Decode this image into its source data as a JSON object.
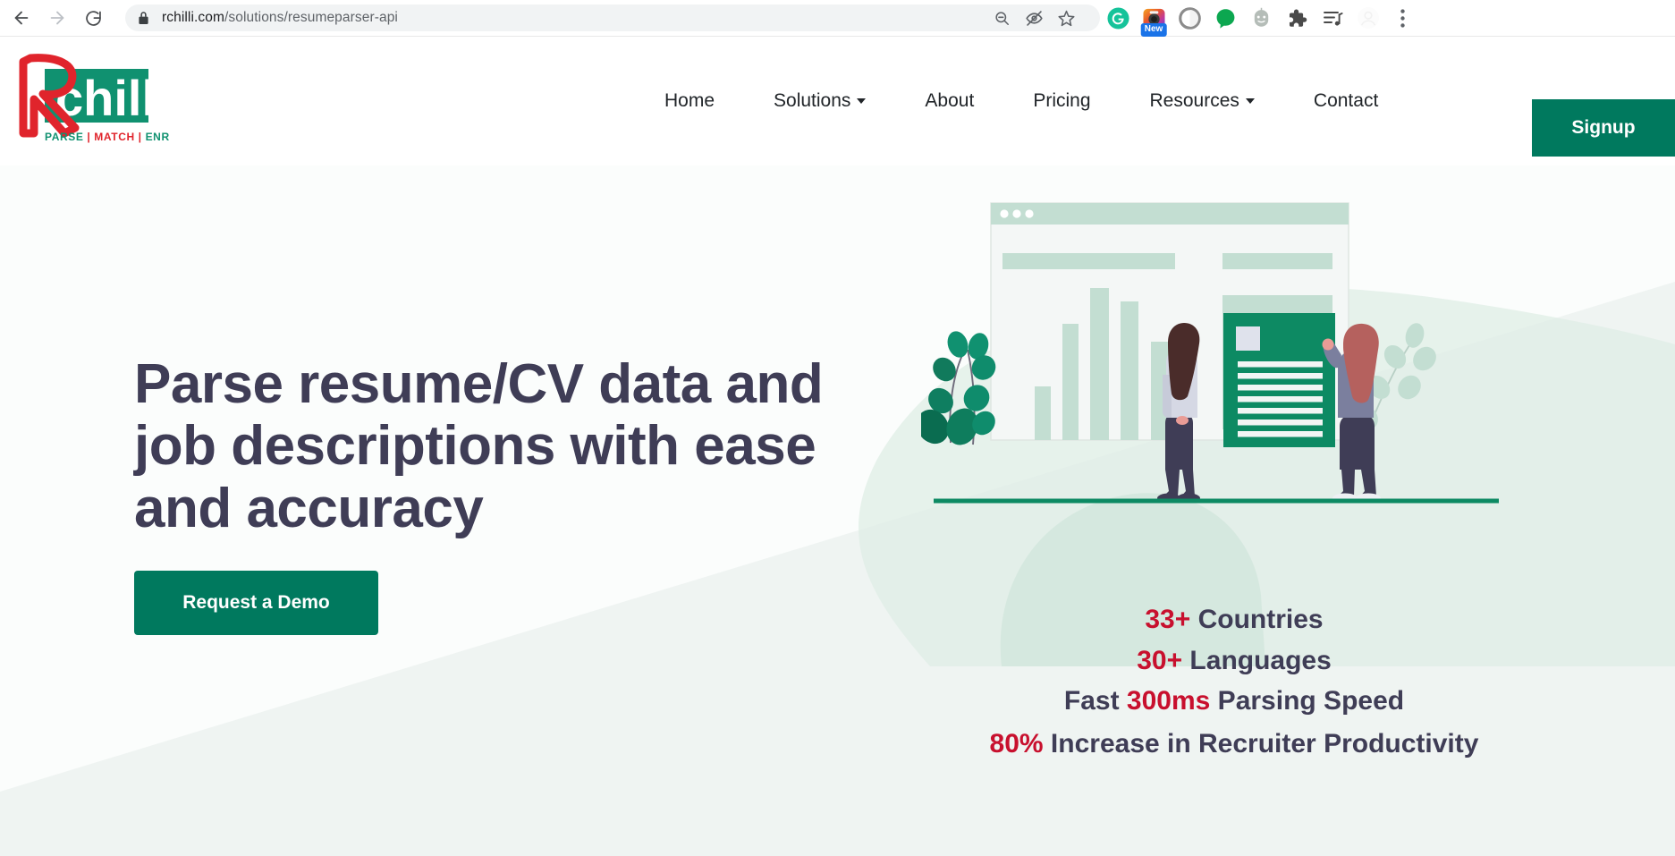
{
  "browser": {
    "back_label": "Back",
    "forward_label": "Forward",
    "reload_label": "Reload",
    "lock_label": "View site information",
    "url_domain": "rchilli.com",
    "url_path": "/solutions/resumeparser-api",
    "url_full": "rchilli.com/solutions/resumeparser-api",
    "omni_actions": [
      {
        "name": "zoom-out-icon",
        "title": "Zoom out"
      },
      {
        "name": "eye-slash-icon",
        "title": "Hide"
      },
      {
        "name": "star-icon",
        "title": "Bookmark this tab"
      }
    ],
    "extensions": [
      {
        "name": "grammarly-extension-icon",
        "letter": "G",
        "color": "#15c39a",
        "badge": ""
      },
      {
        "name": "screenshot-extension-icon",
        "letter": "",
        "color": "#e8592b",
        "badge": "New"
      },
      {
        "name": "circle-extension-icon",
        "letter": "",
        "color": "#8a8a8a",
        "badge": ""
      },
      {
        "name": "green-dot-extension-icon",
        "letter": "",
        "color": "#0ca750",
        "badge": ""
      },
      {
        "name": "robot-extension-icon",
        "letter": "",
        "color": "#b5bdb8",
        "badge": ""
      },
      {
        "name": "puzzle-extensions-icon",
        "letter": "",
        "color": "#4a4a4a",
        "badge": ""
      },
      {
        "name": "reading-list-icon",
        "letter": "",
        "color": "#4a4a4a",
        "badge": ""
      },
      {
        "name": "profile-avatar-icon",
        "letter": "",
        "color": "#eeeeee",
        "badge": ""
      }
    ],
    "menu_label": "Customize and control Google Chrome"
  },
  "site": {
    "logo": {
      "r_letter": "R",
      "word": "chilli",
      "tagline": "PARSE | MATCH | ENRICH",
      "red": "#e0242c",
      "green": "#109170"
    },
    "nav": [
      {
        "label": "Home",
        "has_caret": false
      },
      {
        "label": "Solutions",
        "has_caret": true
      },
      {
        "label": "About",
        "has_caret": false
      },
      {
        "label": "Pricing",
        "has_caret": false
      },
      {
        "label": "Resources",
        "has_caret": true
      },
      {
        "label": "Contact",
        "has_caret": false
      }
    ],
    "signup_label": "Signup"
  },
  "hero": {
    "title": "Parse resume/CV data and job descriptions with ease and accuracy",
    "cta_label": "Request a Demo",
    "accent_green": "#00795e",
    "title_color": "#3f3d56",
    "bg_mint": "#eff4f2",
    "stats": [
      {
        "value": "33+",
        "text": " Countries",
        "prefix": ""
      },
      {
        "value": "30+",
        "text": " Languages",
        "prefix": ""
      },
      {
        "value": "300ms",
        "text": " Parsing Speed",
        "prefix": "Fast "
      },
      {
        "value": "80%",
        "text": " Increase in Recruiter Productivity",
        "prefix": ""
      }
    ],
    "stat_highlight_color": "#c8102e"
  },
  "illustration": {
    "name": "resume-parsing-illustration",
    "description": "Two people standing by a browser window mockup with a bar chart and a green resume document, plants on either side",
    "browser_dots": 3,
    "chart_bars": [
      60,
      130,
      170,
      155,
      110
    ],
    "resume_lines": 7,
    "green": "#0d8a63",
    "mint": "#c3ded2"
  }
}
